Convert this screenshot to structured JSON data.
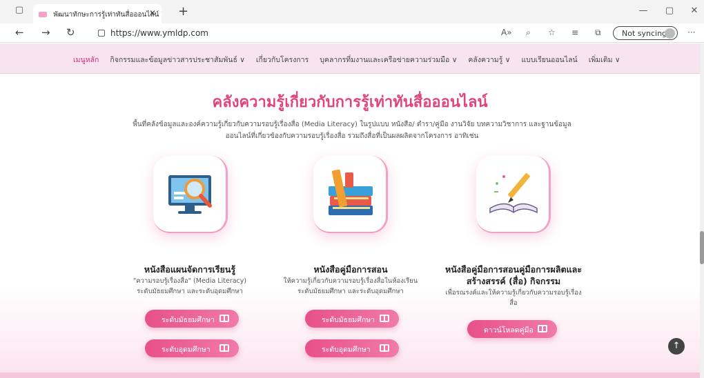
{
  "browser": {
    "tab_title": "พัฒนาทักษะการรู้เท่าทันสื่อออนไลน์ ใน",
    "url": "https://www.ymldp.com",
    "sync_label": "Not syncing"
  },
  "menu": {
    "items": [
      {
        "label": "เมนูหลัก"
      },
      {
        "label": "กิจกรรมและข้อมูลข่าวสารประชาสัมพันธ์ ∨"
      },
      {
        "label": "เกี่ยวกับโครงการ"
      },
      {
        "label": "บุคลากรที่มงานและเครือข่ายความร่วมมือ ∨"
      },
      {
        "label": "คลังความรู้ ∨"
      },
      {
        "label": "แบบเรียนออนไลน์"
      },
      {
        "label": "เพิ่มเติม ∨"
      }
    ]
  },
  "section": {
    "title": "คลังความรู้เกี่ยวกับการรู้เท่าทันสื่อออนไลน์",
    "desc1": "พื้นที่คลังข้อมูลและองค์ความรู้เกี่ยวกับความรอบรู้เรื่องสื่อ (Media Literacy) ในรูปแบบ หนังสือ/ ตำรา/คู่มือ งานวิจัย บทความวิชาการ และฐานข้อมูล",
    "desc2": "ออนไลน์ที่เกี่ยวข้องกับความรอบรู้เรื่องสื่อ รวมถึงสื่อที่เป็นผลผลิตจากโครงการ อาทิเช่น"
  },
  "cards": [
    {
      "title": "หนังสือแผนจัดการเรียนรู้",
      "sub1": "\"ความรอบรู้เรื่องสื่อ\" (Media Literacy)",
      "sub2": "ระดับมัธยมศึกษา และระดับอุดมศึกษา",
      "btn1": "ระดับมัธยมศึกษา",
      "btn2": "ระดับอุดมศึกษา"
    },
    {
      "title": "หนังสือคู่มือการสอน",
      "sub1": "ให้ความรู้เกี่ยวกับความรอบรู้เรื่องสื่อในห้องเรียน",
      "sub2": "ระดับมัธยมศึกษา และระดับอุดมศึกษา",
      "btn1": "ระดับมัธยมศึกษา",
      "btn2": "ระดับอุดมศึกษา"
    },
    {
      "title1": "หนังสือคู่มือการสอนคู่มือการผลิตและ",
      "title2": "สร้างสรรค์ (สื่อ) กิจกรรม",
      "sub1": "เพื่อรณรงค์และให้ความรู้เกี่ยวกับความรอบรู้เรื่อง",
      "sub2": "สื่อ",
      "btn1": "ดาวน์โหลดคู่มือ"
    }
  ],
  "colors": {
    "accent": "#e0447f",
    "menu_bg": "#f7e4ef"
  }
}
